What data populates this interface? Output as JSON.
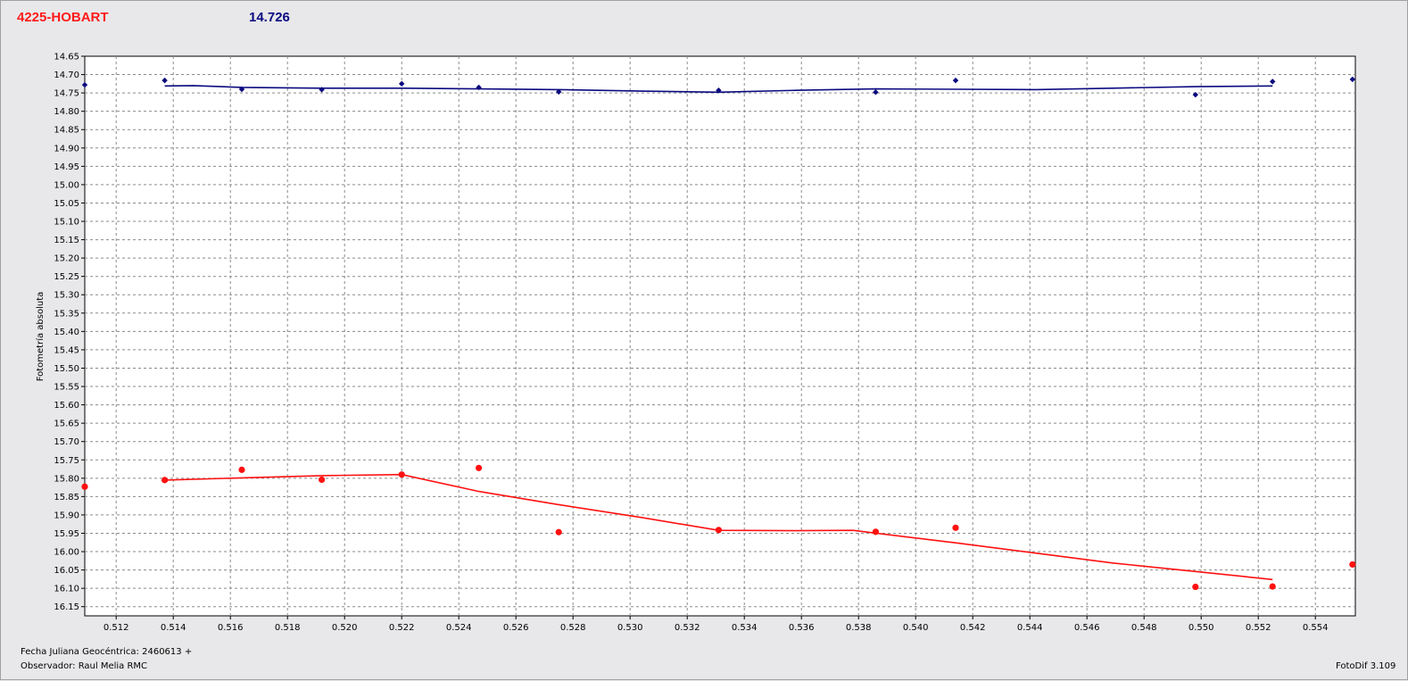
{
  "header": {
    "object_name": "4225-HOBART",
    "reference_magnitude": "14.726"
  },
  "colors": {
    "primary_series": "#0a0a80",
    "secondary_series": "#ff1010",
    "title_red": "#ff1a1a",
    "title_blue": "#0a0a80"
  },
  "footer": {
    "julian_date": "Fecha Juliana Geocéntrica: 2460613 +",
    "observer": "Observador: Raul Melia RMC",
    "software": "FotoDif 3.109"
  },
  "chart_data": {
    "type": "scatter",
    "title": "",
    "xlabel": "",
    "ylabel": "Fotometría absoluta",
    "xlim": [
      0.5109,
      0.5554
    ],
    "ylim": [
      14.65,
      16.175
    ],
    "y_inverted": true,
    "grid": true,
    "x_ticks": [
      "0.512",
      "0.514",
      "0.516",
      "0.518",
      "0.520",
      "0.522",
      "0.524",
      "0.526",
      "0.528",
      "0.530",
      "0.532",
      "0.534",
      "0.536",
      "0.538",
      "0.540",
      "0.542",
      "0.544",
      "0.546",
      "0.548",
      "0.550",
      "0.552",
      "0.554"
    ],
    "y_ticks": [
      "14.65",
      "14.70",
      "14.75",
      "14.80",
      "14.85",
      "14.90",
      "14.95",
      "15.00",
      "15.05",
      "15.10",
      "15.15",
      "15.20",
      "15.25",
      "15.30",
      "15.35",
      "15.40",
      "15.45",
      "15.50",
      "15.55",
      "15.60",
      "15.65",
      "15.70",
      "15.75",
      "15.80",
      "15.85",
      "15.90",
      "15.95",
      "16.00",
      "16.05",
      "16.10",
      "16.15"
    ],
    "series": [
      {
        "color": "#0a0a80",
        "marker": "diamond",
        "points": [
          {
            "x": 0.5109,
            "y": 14.728
          },
          {
            "x": 0.5137,
            "y": 14.716
          },
          {
            "x": 0.5164,
            "y": 14.74
          },
          {
            "x": 0.5192,
            "y": 14.741
          },
          {
            "x": 0.522,
            "y": 14.725
          },
          {
            "x": 0.5247,
            "y": 14.735
          },
          {
            "x": 0.5275,
            "y": 14.747
          },
          {
            "x": 0.5331,
            "y": 14.743
          },
          {
            "x": 0.5386,
            "y": 14.748
          },
          {
            "x": 0.5414,
            "y": 14.716
          },
          {
            "x": 0.5498,
            "y": 14.755
          },
          {
            "x": 0.5525,
            "y": 14.719
          },
          {
            "x": 0.5553,
            "y": 14.713
          }
        ],
        "trend": [
          {
            "x": 0.5137,
            "y": 14.731
          },
          {
            "x": 0.5147,
            "y": 14.73
          },
          {
            "x": 0.5164,
            "y": 14.735
          },
          {
            "x": 0.5192,
            "y": 14.737
          },
          {
            "x": 0.522,
            "y": 14.737
          },
          {
            "x": 0.5247,
            "y": 14.739
          },
          {
            "x": 0.5275,
            "y": 14.741
          },
          {
            "x": 0.5304,
            "y": 14.745
          },
          {
            "x": 0.5331,
            "y": 14.748
          },
          {
            "x": 0.5358,
            "y": 14.743
          },
          {
            "x": 0.5386,
            "y": 14.739
          },
          {
            "x": 0.5414,
            "y": 14.74
          },
          {
            "x": 0.5442,
            "y": 14.741
          },
          {
            "x": 0.5469,
            "y": 14.737
          },
          {
            "x": 0.5498,
            "y": 14.733
          },
          {
            "x": 0.5525,
            "y": 14.731
          }
        ]
      },
      {
        "color": "#ff1010",
        "marker": "circle",
        "points": [
          {
            "x": 0.5109,
            "y": 15.823
          },
          {
            "x": 0.5137,
            "y": 15.805
          },
          {
            "x": 0.5164,
            "y": 15.777
          },
          {
            "x": 0.5192,
            "y": 15.804
          },
          {
            "x": 0.522,
            "y": 15.79
          },
          {
            "x": 0.5247,
            "y": 15.772
          },
          {
            "x": 0.5275,
            "y": 15.947
          },
          {
            "x": 0.5331,
            "y": 15.941
          },
          {
            "x": 0.5386,
            "y": 15.946
          },
          {
            "x": 0.5414,
            "y": 15.935
          },
          {
            "x": 0.5498,
            "y": 16.096
          },
          {
            "x": 0.5525,
            "y": 16.095
          },
          {
            "x": 0.5553,
            "y": 16.035
          }
        ],
        "trend": [
          {
            "x": 0.5137,
            "y": 15.805
          },
          {
            "x": 0.5164,
            "y": 15.799
          },
          {
            "x": 0.5192,
            "y": 15.793
          },
          {
            "x": 0.522,
            "y": 15.79
          },
          {
            "x": 0.5247,
            "y": 15.836
          },
          {
            "x": 0.5275,
            "y": 15.872
          },
          {
            "x": 0.5304,
            "y": 15.907
          },
          {
            "x": 0.5331,
            "y": 15.942
          },
          {
            "x": 0.5358,
            "y": 15.943
          },
          {
            "x": 0.5378,
            "y": 15.942
          },
          {
            "x": 0.5414,
            "y": 15.976
          },
          {
            "x": 0.5442,
            "y": 16.004
          },
          {
            "x": 0.5469,
            "y": 16.031
          },
          {
            "x": 0.5498,
            "y": 16.054
          },
          {
            "x": 0.5525,
            "y": 16.076
          }
        ]
      }
    ]
  }
}
